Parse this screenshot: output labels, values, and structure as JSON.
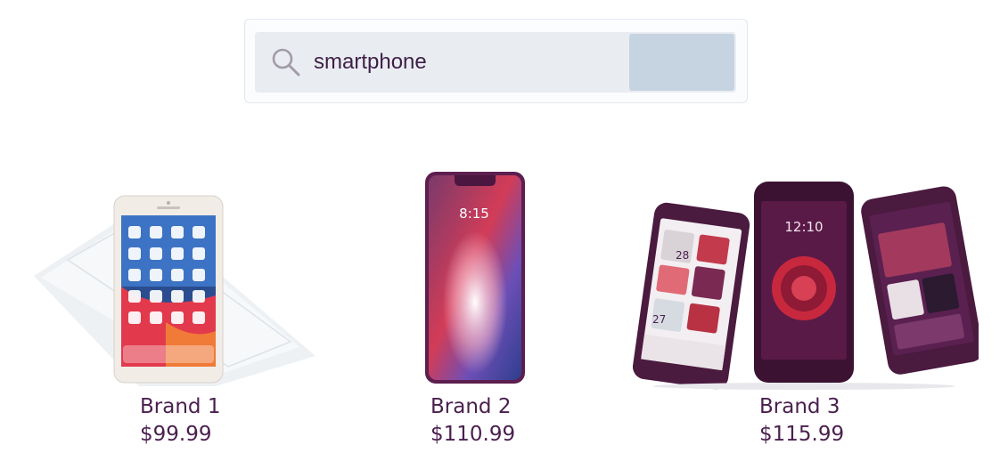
{
  "search": {
    "value": "smartphone",
    "button_label": ""
  },
  "products": [
    {
      "name": "Brand 1",
      "price": "$99.99"
    },
    {
      "name": "Brand 2",
      "price": "$110.99"
    },
    {
      "name": "Brand 3",
      "price": "$115.99"
    }
  ],
  "phone_screens": {
    "p2_time": "8:15",
    "p3_time": "12:10",
    "p3_tile_a": "28",
    "p3_tile_b": "27"
  },
  "colors": {
    "text": "#4a1f4e",
    "search_field": "#e9edf2",
    "search_button": "#c6d3e1",
    "accent_red": "#e23a4c",
    "accent_purple": "#6c2a5f"
  }
}
